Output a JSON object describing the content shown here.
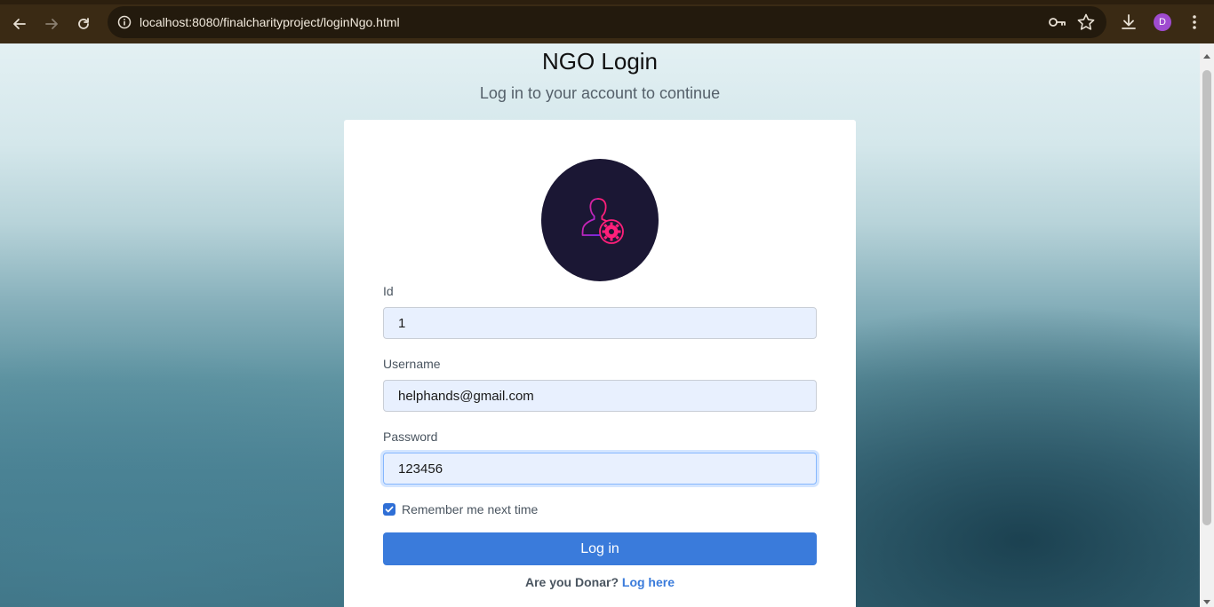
{
  "browser": {
    "url": "localhost:8080/finalcharityproject/loginNgo.html",
    "profile_initial": "D"
  },
  "page": {
    "title": "NGO Login",
    "subtitle": "Log in to your account to continue"
  },
  "form": {
    "id_label": "Id",
    "id_value": "1",
    "username_label": "Username",
    "username_value": "helphands@gmail.com",
    "password_label": "Password",
    "password_value": "123456",
    "remember_label": "Remember me next time",
    "remember_checked": true,
    "login_label": "Log in",
    "donor_prompt": "Are you Donar?",
    "donor_link": "Log here"
  },
  "icons": {
    "back": "back-arrow-icon",
    "forward": "forward-arrow-icon",
    "reload": "reload-icon",
    "site_info": "site-info-icon",
    "key": "key-icon",
    "star": "star-icon",
    "download": "download-icon",
    "menu": "kebab-menu-icon",
    "logo": "user-gear-icon"
  },
  "colors": {
    "primary": "#3a7bdb",
    "logo_bg": "#1b1734",
    "input_bg": "#e8f0fe",
    "toolbar": "#3a2a14"
  }
}
